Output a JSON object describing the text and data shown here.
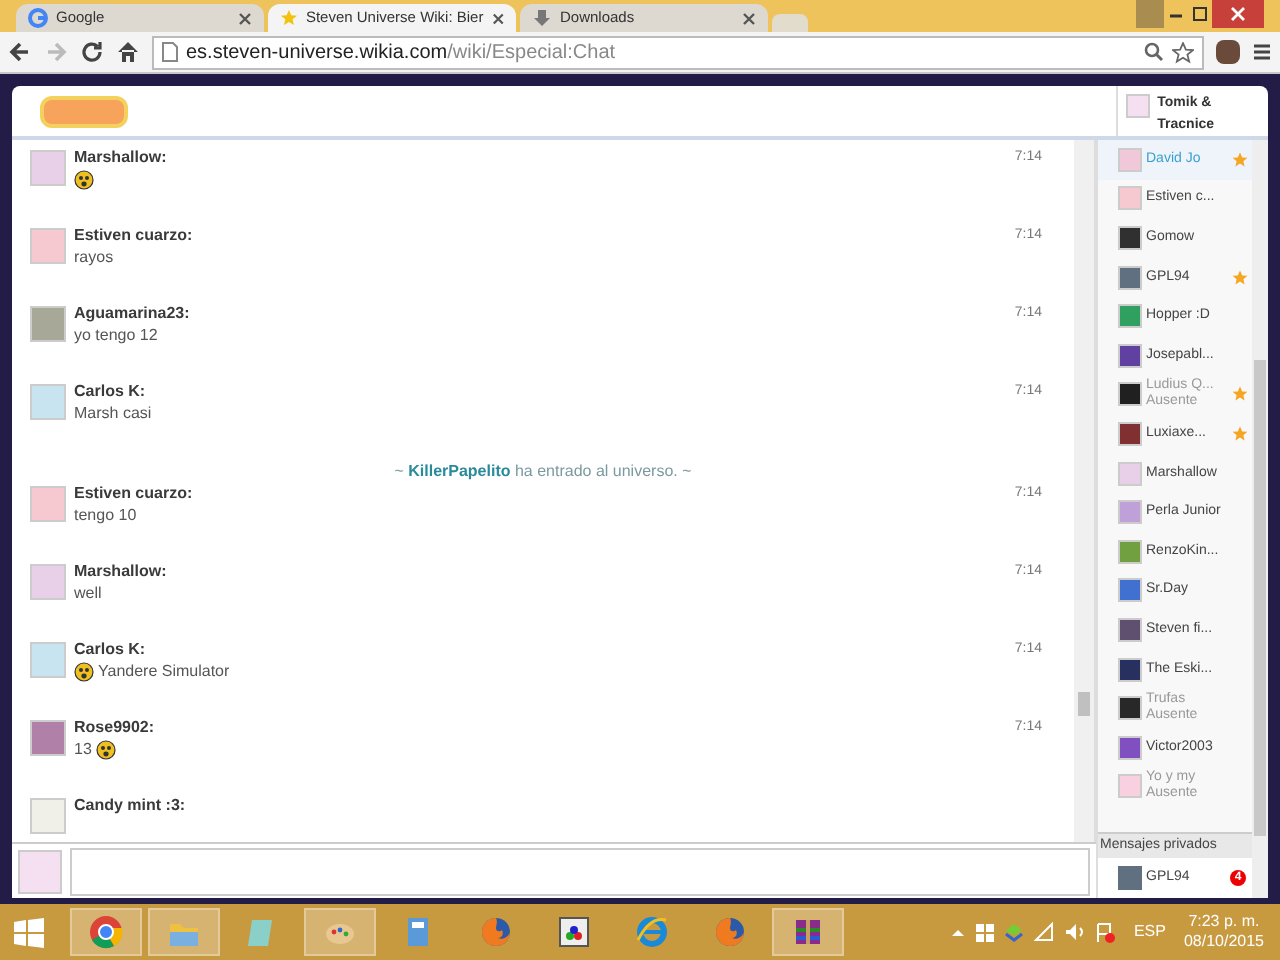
{
  "browser": {
    "tabs": [
      {
        "title": "Google",
        "selected": false
      },
      {
        "title": "Steven Universe Wiki: Bier",
        "selected": true
      },
      {
        "title": "Downloads",
        "selected": false
      }
    ],
    "url_host": "es.steven-universe.wikia.com",
    "url_path": "/wiki/Especial:Chat"
  },
  "header": {
    "user": "Tomik & Tracnice"
  },
  "messages": [
    {
      "kind": "emote",
      "user": "Marshallow:",
      "time": "7:14"
    },
    {
      "kind": "text",
      "user": "Estiven cuarzo:",
      "text": "rayos",
      "time": "7:14"
    },
    {
      "kind": "text",
      "user": "Aguamarina23:",
      "text": "yo tengo 12",
      "time": "7:14"
    },
    {
      "kind": "text",
      "user": "Carlos K:",
      "text": "Marsh casi",
      "time": "7:14"
    },
    {
      "kind": "join",
      "user": "KillerPapelito",
      "prefix": "~",
      "text": "ha entrado al universo.",
      "suffix": "~"
    },
    {
      "kind": "text",
      "user": "Estiven cuarzo:",
      "text": "tengo 10",
      "time": "7:14"
    },
    {
      "kind": "text",
      "user": "Marshallow:",
      "text": "well",
      "time": "7:14"
    },
    {
      "kind": "emotetext",
      "user": "Carlos K:",
      "text": "Yandere Simulator",
      "time": "7:14"
    },
    {
      "kind": "textemote",
      "user": "Rose9902:",
      "text": "13",
      "time": "7:14"
    },
    {
      "kind": "text",
      "user": "Candy mint :3:"
    }
  ],
  "users": [
    {
      "name": "David Jo",
      "selected": true,
      "starred": true
    },
    {
      "name": "Estiven c...",
      "selected": false,
      "starred": false
    },
    {
      "name": "Gomow",
      "selected": false,
      "starred": false
    },
    {
      "name": "GPL94",
      "selected": false,
      "starred": true
    },
    {
      "name": "Hopper :D",
      "selected": false,
      "starred": false
    },
    {
      "name": "Josepabl...",
      "selected": false,
      "starred": false
    },
    {
      "name": "Ludius Q...",
      "status": "Ausente",
      "selected": false,
      "starred": true
    },
    {
      "name": "Luxiaxe...",
      "selected": false,
      "starred": true
    },
    {
      "name": "Marshallow",
      "selected": false,
      "starred": false
    },
    {
      "name": "Perla Junior",
      "selected": false,
      "starred": false
    },
    {
      "name": "RenzoKin...",
      "selected": false,
      "starred": false
    },
    {
      "name": "Sr.Day",
      "selected": false,
      "starred": false
    },
    {
      "name": "Steven fi...",
      "selected": false,
      "starred": false
    },
    {
      "name": "The Eski...",
      "selected": false,
      "starred": false
    },
    {
      "name": "Trufas",
      "status": "Ausente",
      "selected": false,
      "starred": false
    },
    {
      "name": "Victor2003",
      "selected": false,
      "starred": false
    },
    {
      "name": "Yo y my",
      "status": "Ausente",
      "selected": false,
      "starred": false
    }
  ],
  "private_messages": {
    "title": "Mensajes privados",
    "items": [
      {
        "name": "GPL94",
        "badge": "4"
      }
    ]
  },
  "taskbar": {
    "apps": [
      {
        "selected": true
      },
      {
        "selected": true
      },
      {
        "selected": false
      },
      {
        "selected": true
      },
      {
        "selected": false
      },
      {
        "selected": false
      },
      {
        "selected": false
      },
      {
        "selected": false
      },
      {
        "selected": false
      },
      {
        "selected": true
      }
    ],
    "language": "ESP",
    "time": "7:23 p. m.",
    "date": "08/10/2015"
  }
}
